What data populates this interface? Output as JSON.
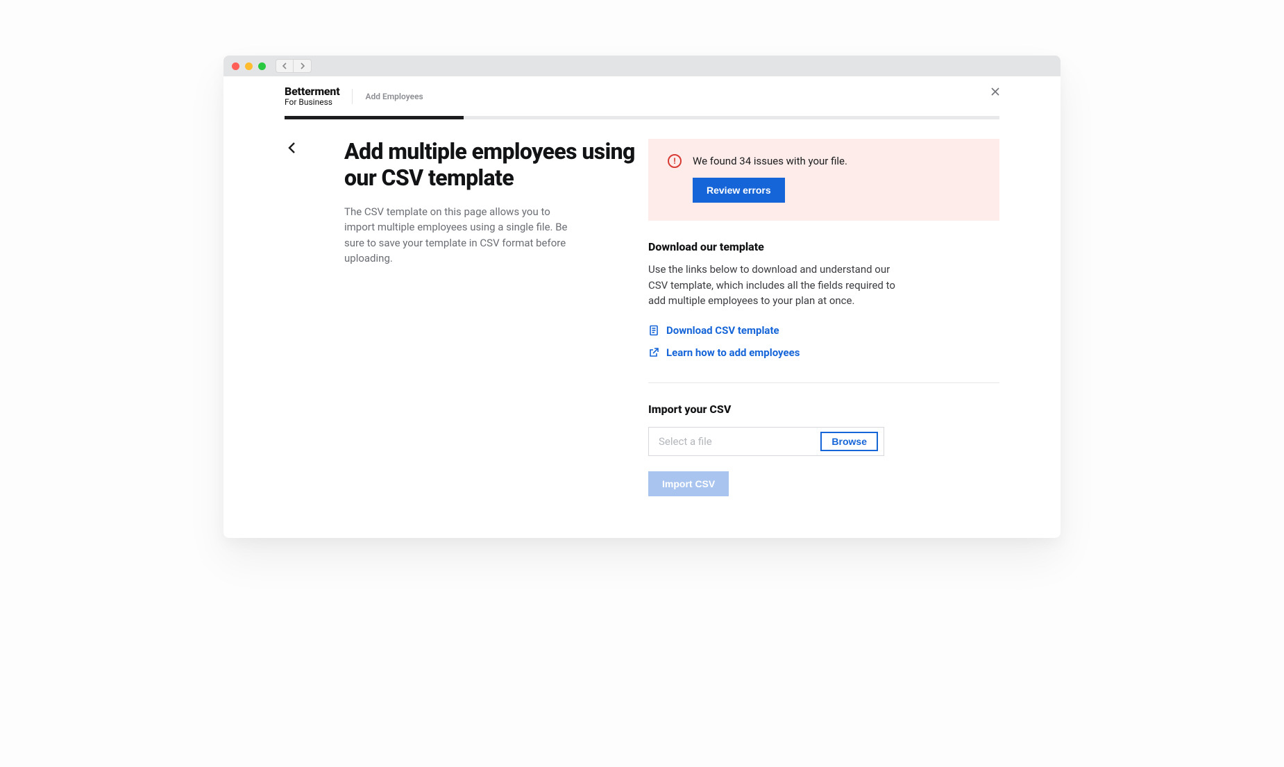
{
  "brand": {
    "main": "Betterment",
    "sub": "For Business"
  },
  "breadcrumb": "Add Employees",
  "progress": {
    "percent": 25
  },
  "page": {
    "title": "Add multiple employees using our CSV template",
    "description": "The CSV template on this page allows you to import multiple employees using a single file. Be sure to save your template in CSV format before uploading."
  },
  "alert": {
    "message": "We found 34 issues with your file.",
    "action_label": "Review errors"
  },
  "template_section": {
    "heading": "Download our template",
    "body": "Use the links below to download and understand our CSV template, which includes all the fields required to add multiple employees to your plan at once.",
    "links": {
      "download": "Download CSV template",
      "learn": "Learn how to add employees"
    }
  },
  "import_section": {
    "heading": "Import your CSV",
    "placeholder": "Select a file",
    "browse_label": "Browse",
    "import_label": "Import CSV"
  }
}
